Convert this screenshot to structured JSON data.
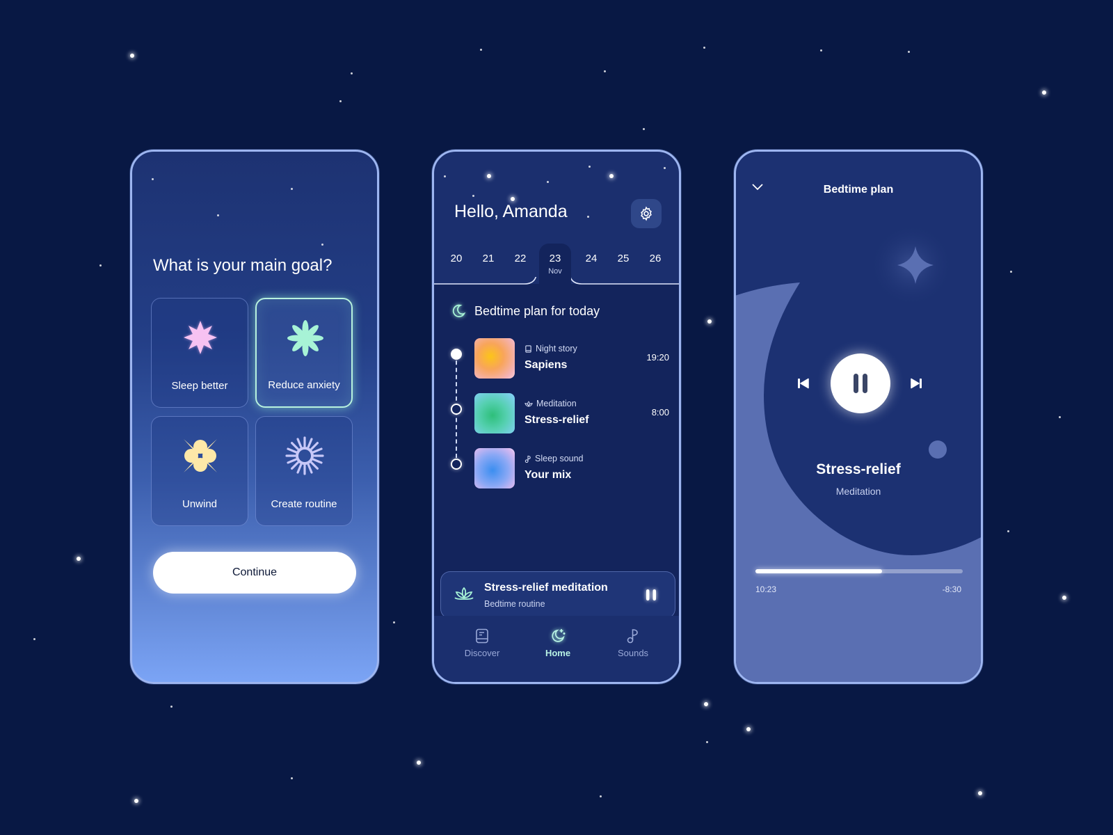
{
  "colors": {
    "background": "#081844",
    "frame_border": "#9db5f0",
    "accent_mint": "#b8f2de",
    "goal_sleep": "#f7b8f0",
    "goal_anxiety": "#a7f3d6",
    "goal_unwind": "#fde8a8",
    "goal_routine": "#c8c8f8"
  },
  "goal_screen": {
    "question": "What is your main goal?",
    "options": [
      {
        "label": "Sleep better",
        "icon": "pink-burst-icon",
        "selected": false
      },
      {
        "label": "Reduce anxiety",
        "icon": "mint-flower-icon",
        "selected": true
      },
      {
        "label": "Unwind",
        "icon": "yellow-flower-icon",
        "selected": false
      },
      {
        "label": "Create routine",
        "icon": "lavender-sun-icon",
        "selected": false
      }
    ],
    "continue_label": "Continue"
  },
  "home_screen": {
    "greeting": "Hello, Amanda",
    "settings_icon": "gear-icon",
    "calendar": {
      "days": [
        "20",
        "21",
        "22",
        "23",
        "24",
        "25",
        "26"
      ],
      "selected_day": "23",
      "selected_month": "Nov"
    },
    "plan_title": "Bedtime plan for today",
    "plan_items": [
      {
        "category": "Night story",
        "category_icon": "book-icon",
        "title": "Sapiens",
        "time": "19:20"
      },
      {
        "category": "Meditation",
        "category_icon": "lotus-icon",
        "title": "Stress-relief",
        "time": "8:00"
      },
      {
        "category": "Sleep sound",
        "category_icon": "music-note-icon",
        "title": "Your mix",
        "time": ""
      }
    ],
    "mini_player": {
      "title": "Stress-relief meditation",
      "subtitle": "Bedtime routine",
      "state": "playing"
    },
    "nav": [
      {
        "label": "Discover",
        "icon": "book-icon",
        "active": false
      },
      {
        "label": "Home",
        "icon": "moon-stars-icon",
        "active": true
      },
      {
        "label": "Sounds",
        "icon": "music-note-icon",
        "active": false
      }
    ]
  },
  "player_screen": {
    "title": "Bedtime plan",
    "track_title": "Stress-relief",
    "track_subtitle": "Meditation",
    "elapsed": "10:23",
    "remaining": "-8:30",
    "progress": 0.61,
    "state": "playing"
  }
}
